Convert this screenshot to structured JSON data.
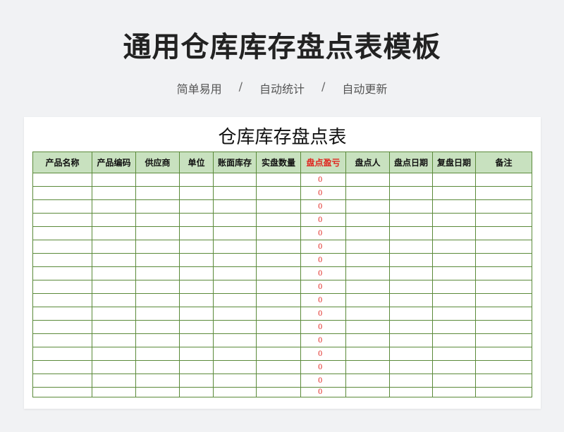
{
  "header": {
    "title": "通用仓库库存盘点表模板",
    "features": [
      "简单易用",
      "自动统计",
      "自动更新"
    ],
    "separator": "/"
  },
  "sheet": {
    "title": "仓库库存盘点表",
    "columns": [
      "产品名称",
      "产品编码",
      "供应商",
      "单位",
      "账面库存",
      "实盘数量",
      "盘点盈亏",
      "盘点人",
      "盘点日期",
      "复盘日期",
      "备注"
    ],
    "highlight_column": "盘点盈亏",
    "row_diff_values": [
      "0",
      "0",
      "0",
      "0",
      "0",
      "0",
      "0",
      "0",
      "0",
      "0",
      "0",
      "0",
      "0",
      "0",
      "0",
      "0",
      "0"
    ],
    "colors": {
      "header_bg": "#c8e1bf",
      "border": "#5b8a3a",
      "accent_red": "#e0251f"
    }
  }
}
